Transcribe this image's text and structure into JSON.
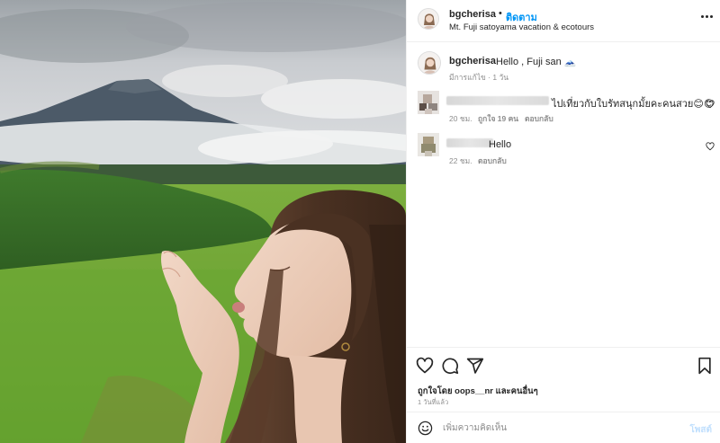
{
  "post": {
    "username": "bgcherisa",
    "separator": "•",
    "follow_label": "ติดตาม",
    "location": "Mt. Fuji satoyama vacation & ecotours",
    "caption": {
      "username": "bgcherisa",
      "text": "Hello , Fuji san 🗻",
      "meta": "มีการแก้ไข · 1 วัน"
    },
    "comments": [
      {
        "text": "ไปเที่ยวกับใบรัทสนุกมั้ยคะคนสวย😊😊",
        "time": "20 ชม.",
        "likes": "ถูกใจ 19 คน",
        "reply": "ตอบกลับ"
      },
      {
        "text": "Hello",
        "time": "22 ชม.",
        "reply": "ตอบกลับ"
      }
    ],
    "liked_by": "ถูกใจโดย oops__nr และคนอื่นๆ",
    "time_ago": "1 วันที่แล้ว",
    "comment_placeholder": "เพิ่มความคิดเห็น",
    "post_button": "โพสต์"
  },
  "icons": {
    "more": "more-horizontal-icon",
    "like": "heart-outline-icon",
    "comment": "comment-bubble-icon",
    "share": "paper-plane-icon",
    "save": "bookmark-icon",
    "emoji": "smiley-icon"
  },
  "colors": {
    "link_blue": "#0095f6",
    "muted": "#8e8e8e",
    "text": "#262626",
    "post_disabled": "#c0dffd"
  }
}
